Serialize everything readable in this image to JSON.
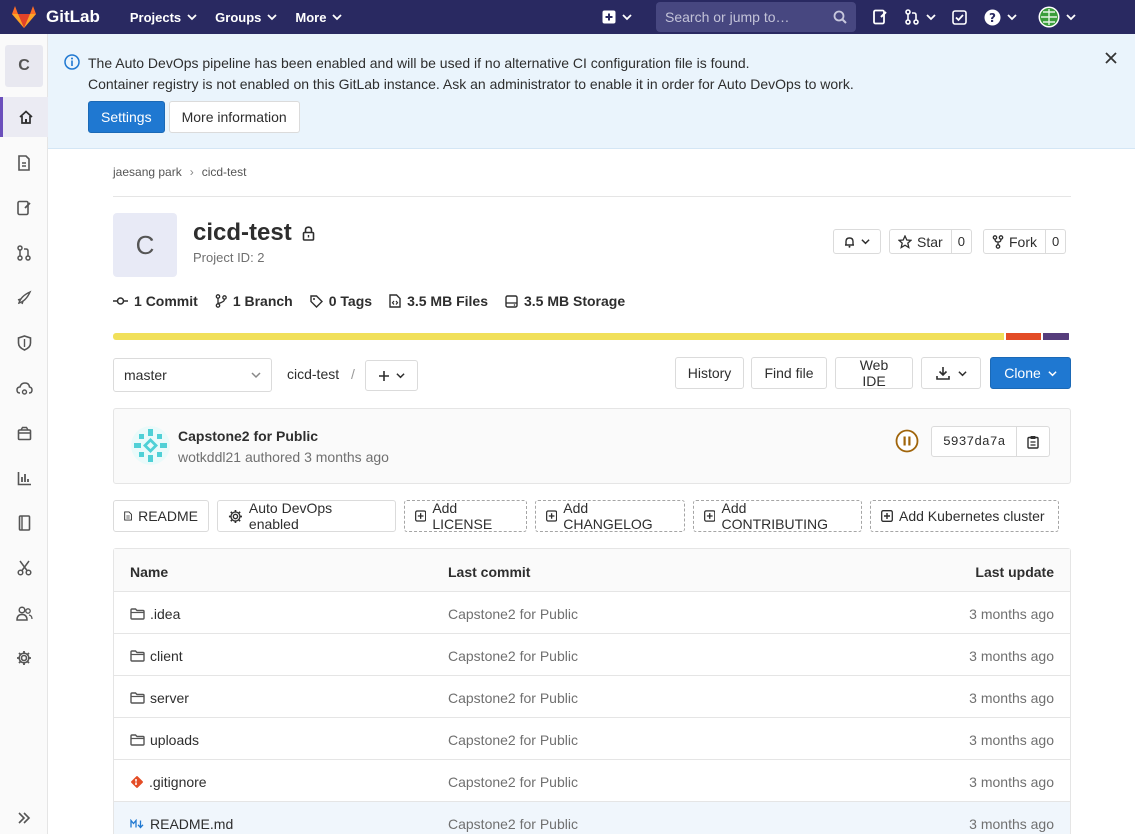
{
  "navbar": {
    "brand": "GitLab",
    "menu": [
      {
        "label": "Projects"
      },
      {
        "label": "Groups"
      },
      {
        "label": "More"
      }
    ],
    "search_placeholder": "Search or jump to…"
  },
  "sidebar": {
    "project_initial": "C"
  },
  "alert": {
    "line1": "The Auto DevOps pipeline has been enabled and will be used if no alternative CI configuration file is found.",
    "line2": "Container registry is not enabled on this GitLab instance. Ask an administrator to enable it in order for Auto DevOps to work.",
    "settings_label": "Settings",
    "more_info_label": "More information"
  },
  "breadcrumb": {
    "owner": "jaesang park",
    "project": "cicd-test"
  },
  "project": {
    "initial": "C",
    "name": "cicd-test",
    "id_text": "Project ID: 2",
    "star_label": "Star",
    "star_count": "0",
    "fork_label": "Fork",
    "fork_count": "0"
  },
  "stats": {
    "commits_count": "1",
    "commits_label": "Commit",
    "branches_count": "1",
    "branches_label": "Branch",
    "tags_count": "0",
    "tags_label": "Tags",
    "files_size": "3.5 MB",
    "files_label": "Files",
    "storage_size": "3.5 MB",
    "storage_label": "Storage"
  },
  "languages": [
    {
      "color": "#f1e05a",
      "fraction": 0.932
    },
    {
      "color": "#e34c26",
      "fraction": 0.039
    },
    {
      "color": "#563d7c",
      "fraction": 0.029
    }
  ],
  "tree": {
    "branch": "master",
    "path": "cicd-test",
    "path_separator": "/",
    "history_label": "History",
    "find_file_label": "Find file",
    "web_ide_label": "Web IDE",
    "clone_label": "Clone"
  },
  "commit": {
    "title": "Capstone2 for Public",
    "author": "wotkddl21",
    "meta_suffix": "authored 3 months ago",
    "sha": "5937da7a"
  },
  "quick_links": {
    "readme": "README",
    "auto_devops": "Auto DevOps enabled",
    "add_license": "Add LICENSE",
    "add_changelog": "Add CHANGELOG",
    "add_contributing": "Add CONTRIBUTING",
    "add_kubernetes": "Add Kubernetes cluster"
  },
  "files": {
    "headers": {
      "name": "Name",
      "last_commit": "Last commit",
      "last_update": "Last update"
    },
    "rows": [
      {
        "name": ".idea",
        "type": "folder",
        "commit": "Capstone2 for Public",
        "updated": "3 months ago"
      },
      {
        "name": "client",
        "type": "folder",
        "commit": "Capstone2 for Public",
        "updated": "3 months ago"
      },
      {
        "name": "server",
        "type": "folder",
        "commit": "Capstone2 for Public",
        "updated": "3 months ago"
      },
      {
        "name": "uploads",
        "type": "folder",
        "commit": "Capstone2 for Public",
        "updated": "3 months ago"
      },
      {
        "name": ".gitignore",
        "type": "git",
        "commit": "Capstone2 for Public",
        "updated": "3 months ago"
      },
      {
        "name": "README.md",
        "type": "markdown",
        "commit": "Capstone2 for Public",
        "updated": "3 months ago"
      }
    ]
  }
}
